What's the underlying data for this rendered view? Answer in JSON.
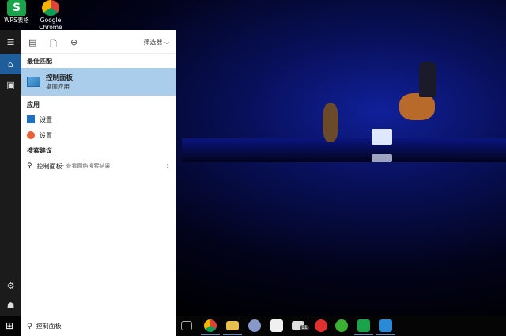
{
  "desktop": {
    "icons": [
      {
        "label": "WPS表格",
        "color": "#1aa34a"
      },
      {
        "label": "Google Chrome",
        "color": "#e8b020"
      }
    ]
  },
  "panel": {
    "header": {
      "filter_label": "筛选器"
    },
    "best_match": {
      "heading": "最佳匹配",
      "title": "控制面板",
      "subtitle": "桌面应用"
    },
    "apps": {
      "heading": "应用",
      "items": [
        "设置",
        "设置"
      ]
    },
    "suggestions": {
      "heading": "搜索建议",
      "query": "控制面板",
      "hint": " - 查看网络搜索结果"
    }
  },
  "search": {
    "value": "控制面板"
  },
  "taskbar": {
    "mail_badge": "11"
  },
  "colors": {
    "highlight": "#a9cdea",
    "sidebar": "#1b1b1b",
    "active": "#1f5e9a"
  }
}
